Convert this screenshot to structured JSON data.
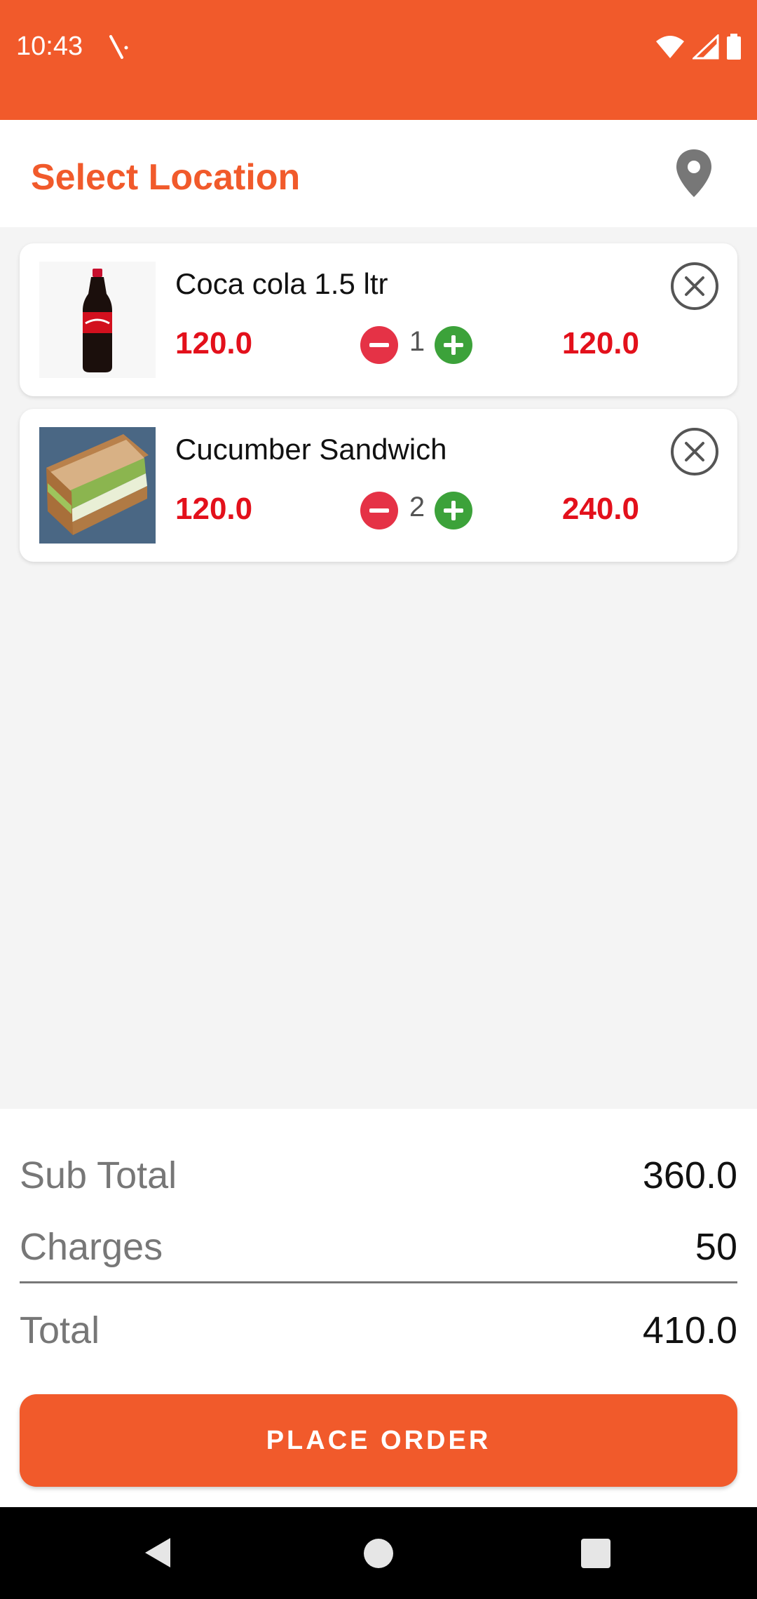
{
  "status_bar": {
    "time": "10:43",
    "color": "#f15a2b"
  },
  "header": {
    "title": "Select Location",
    "icon": "location-pin-icon",
    "title_color": "#f15a2b"
  },
  "cart": {
    "items": [
      {
        "name": "Coca cola 1.5 ltr",
        "unit_price": "120.0",
        "quantity": "1",
        "line_total": "120.0",
        "image": "coca-cola-bottle-image"
      },
      {
        "name": "Cucumber Sandwich",
        "unit_price": "120.0",
        "quantity": "2",
        "line_total": "240.0",
        "image": "cucumber-sandwich-image"
      }
    ],
    "price_color": "#e3101b"
  },
  "summary": {
    "sub_total_label": "Sub Total",
    "sub_total_value": "360.0",
    "charges_label": "Charges",
    "charges_value": "50",
    "total_label": "Total",
    "total_value": "410.0"
  },
  "actions": {
    "place_order_label": "PLACE ORDER",
    "accent_color": "#f15a2b"
  }
}
